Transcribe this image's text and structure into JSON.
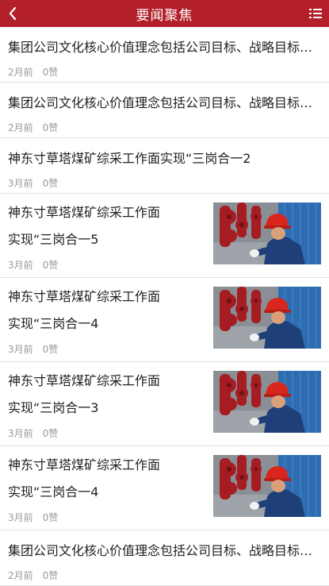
{
  "header": {
    "title": "要闻聚焦"
  },
  "items": [
    {
      "title": "集团公司文化核心价值理念包括公司目标、战略目标、发展理念",
      "time": "2月前",
      "likes": "0赞"
    },
    {
      "title": "集团公司文化核心价值理念包括公司目标、战略目标、发展理念",
      "time": "2月前",
      "likes": "0赞"
    },
    {
      "title": "神东寸草塔煤矿综采工作面实现“三岗合一2",
      "time": "3月前",
      "likes": "0赞"
    },
    {
      "title_line1": "神东寸草塔煤矿综采工作面",
      "title_line2": "实现“三岗合一5",
      "time": "3月前",
      "likes": "0赞"
    },
    {
      "title_line1": "神东寸草塔煤矿综采工作面",
      "title_line2": "实现“三岗合一4",
      "time": "3月前",
      "likes": "0赞"
    },
    {
      "title_line1": "神东寸草塔煤矿综采工作面",
      "title_line2": "实现“三岗合一3",
      "time": "3月前",
      "likes": "0赞"
    },
    {
      "title_line1": "神东寸草塔煤矿综采工作面",
      "title_line2": "实现“三岗合一4",
      "time": "3月前",
      "likes": "0赞"
    },
    {
      "title": "集团公司文化核心价值理念包括公司目标、战略目标、发展理念",
      "time": "2月前",
      "likes": "0赞"
    }
  ],
  "icons": {
    "back": "chevron-left-icon",
    "menu": "list-menu-icon"
  },
  "colors": {
    "header_bg": "#b3202a",
    "meta_text": "#999999"
  }
}
